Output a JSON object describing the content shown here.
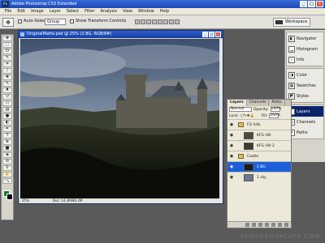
{
  "app": {
    "title": "Adobe Photoshop CS3 Extended",
    "logo": "Ps"
  },
  "window_buttons": [
    "_",
    "□",
    "×"
  ],
  "menu": [
    "File",
    "Edit",
    "Image",
    "Layer",
    "Select",
    "Filter",
    "Analysis",
    "View",
    "Window",
    "Help"
  ],
  "options": {
    "auto_select_label": "Auto-Select:",
    "auto_select_value": "Group",
    "show_transform_label": "Show Transform Controls",
    "workspace_label": "Workspace"
  },
  "document": {
    "title": "OriginalMatte.psd @ 25% (2 BG, RGB/8#)",
    "zoom": "25%",
    "doc_size": "Doc: 14.3M/80.2M"
  },
  "dock": {
    "group1": [
      "Navigator",
      "Histogram",
      "Info"
    ],
    "group2": [
      "Color",
      "Swatches",
      "Styles"
    ],
    "group3": [
      "Layers",
      "Channels",
      "Paths"
    ]
  },
  "layers_panel": {
    "tabs": [
      "Layers",
      "Channels",
      "Paths"
    ],
    "blend_mode": "Normal",
    "opacity_label": "Opacity:",
    "opacity_value": "100%",
    "lock_label": "Lock:",
    "fill_label": "Fill:",
    "fill_value": "100%",
    "layers": [
      {
        "name": "FG hills",
        "type": "group"
      },
      {
        "name": "KFG Hill",
        "type": "layer"
      },
      {
        "name": "KFG Hill 2",
        "type": "layer"
      },
      {
        "name": "Castle",
        "type": "group"
      },
      {
        "name": "2 BG",
        "type": "layer",
        "selected": true
      },
      {
        "name": "1 sky",
        "type": "layer"
      }
    ]
  },
  "watermark": "PHOTOSHOPCAFE.COM",
  "colors": {
    "foreground": "#0b7d2c",
    "background": "#000000",
    "titlebar": "#1c48b8",
    "selection": "#1e5fd8"
  }
}
